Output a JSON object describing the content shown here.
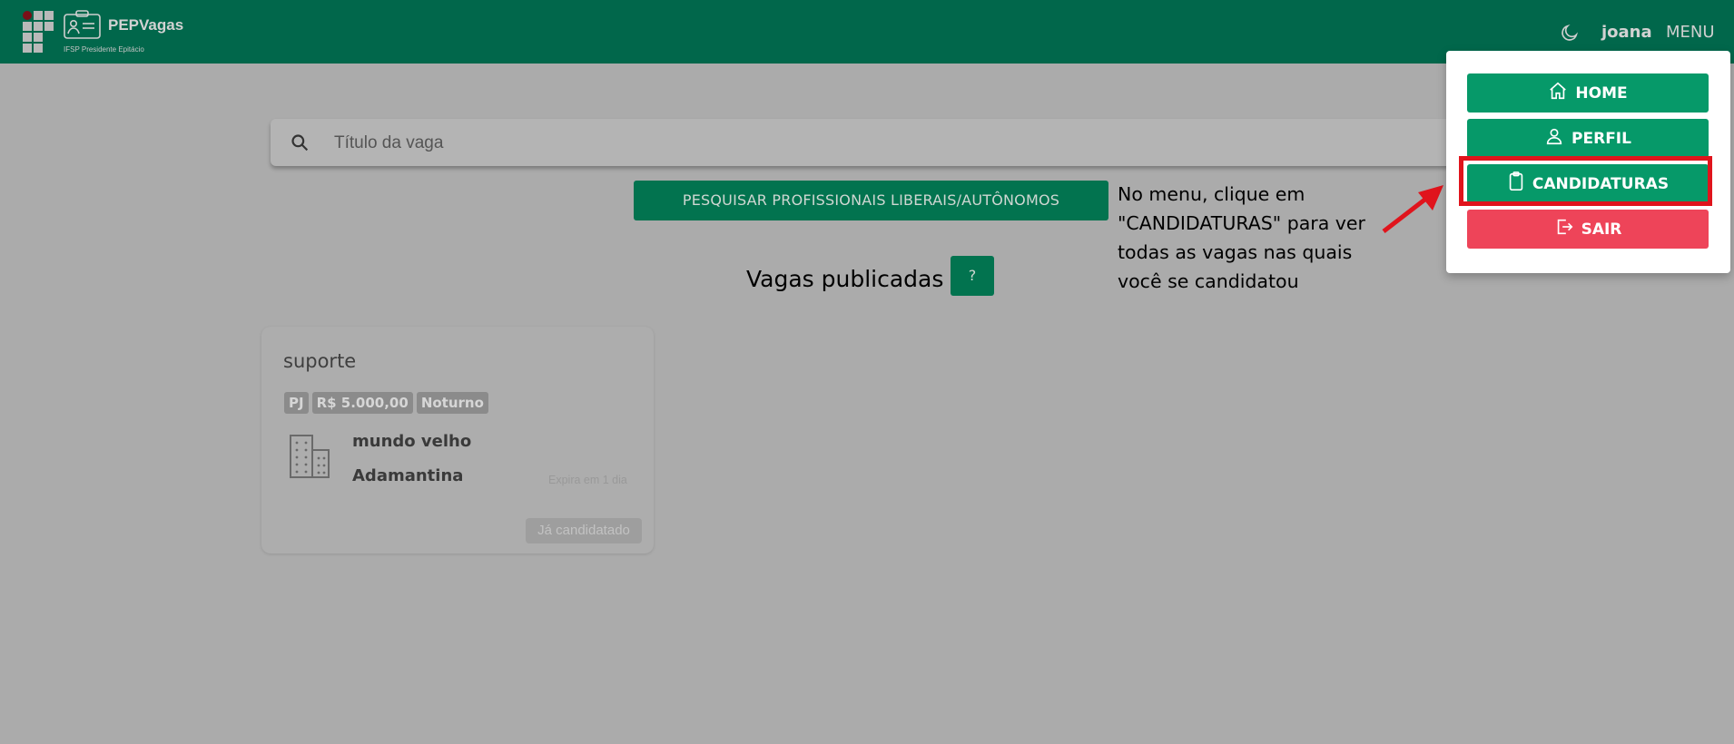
{
  "header": {
    "app_name": "PEPVagas",
    "subtitle": "IFSP Presidente Epitácio",
    "username": "joana",
    "menu_label": "MENU"
  },
  "search": {
    "placeholder": "Título da vaga",
    "value": ""
  },
  "actions": {
    "search_professionals_label": "PESQUISAR PROFISSIONAIS LIBERAIS/AUTÔNOMOS",
    "help_label": "?"
  },
  "section": {
    "title": "Vagas publicadas"
  },
  "job_card": {
    "title": "suporte",
    "badges": [
      "PJ",
      "R$ 5.000,00",
      "Noturno"
    ],
    "company": "mundo velho",
    "city": "Adamantina",
    "expires": "Expira em 1 dia",
    "status_button": "Já candidatado"
  },
  "menu": {
    "items": [
      {
        "label": "HOME",
        "icon": "home-icon"
      },
      {
        "label": "PERFIL",
        "icon": "user-icon"
      },
      {
        "label": "CANDIDATURAS",
        "icon": "clipboard-icon"
      },
      {
        "label": "SAIR",
        "icon": "logout-icon"
      }
    ]
  },
  "annotation": {
    "lines": [
      "No menu, clique em",
      "\"CANDIDATURAS\" para ver",
      "todas as vagas nas quais",
      "você se candidatou"
    ]
  },
  "colors": {
    "primary": "#01674b",
    "menu_button": "#069969",
    "danger": "#ee4459",
    "highlight": "#e0141c",
    "overlay_background": "#ababab"
  }
}
